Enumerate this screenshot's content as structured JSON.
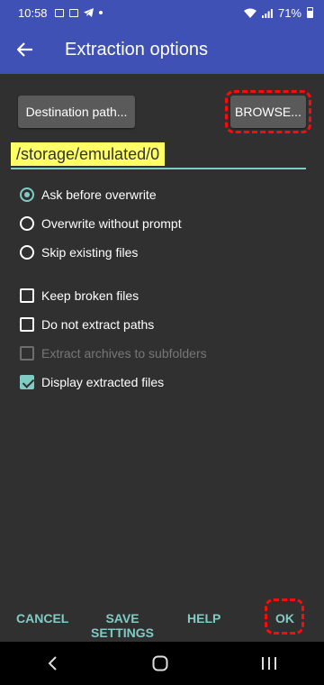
{
  "status_bar": {
    "time": "10:58",
    "battery_percent": "71%",
    "icons": [
      "gallery-icon",
      "mail-icon",
      "telegram-icon",
      "notification-dot-icon",
      "wifi-icon",
      "signal-icon",
      "battery-icon"
    ]
  },
  "appbar": {
    "title": "Extraction options",
    "back_icon": "arrow-left-icon"
  },
  "buttons": {
    "destination": "Destination path...",
    "browse": "BROWSE..."
  },
  "path": {
    "value": "/storage/emulated/0"
  },
  "overwrite_options": [
    {
      "label": "Ask before overwrite",
      "selected": true
    },
    {
      "label": "Overwrite without prompt",
      "selected": false
    },
    {
      "label": "Skip existing files",
      "selected": false
    }
  ],
  "checkboxes": [
    {
      "label": "Keep broken files",
      "checked": false,
      "enabled": true
    },
    {
      "label": "Do not extract paths",
      "checked": false,
      "enabled": true
    },
    {
      "label": "Extract archives to subfolders",
      "checked": false,
      "enabled": false
    },
    {
      "label": "Display extracted files",
      "checked": true,
      "enabled": true
    }
  ],
  "actions": {
    "cancel": "CANCEL",
    "save_line1": "SAVE",
    "save_line2": "SETTINGS",
    "help": "HELP",
    "ok": "OK"
  },
  "colors": {
    "primary": "#3f51b5",
    "accent": "#80cbc4",
    "background": "#303030",
    "highlight": "#ffff66",
    "annotation": "#ff0a0a"
  }
}
